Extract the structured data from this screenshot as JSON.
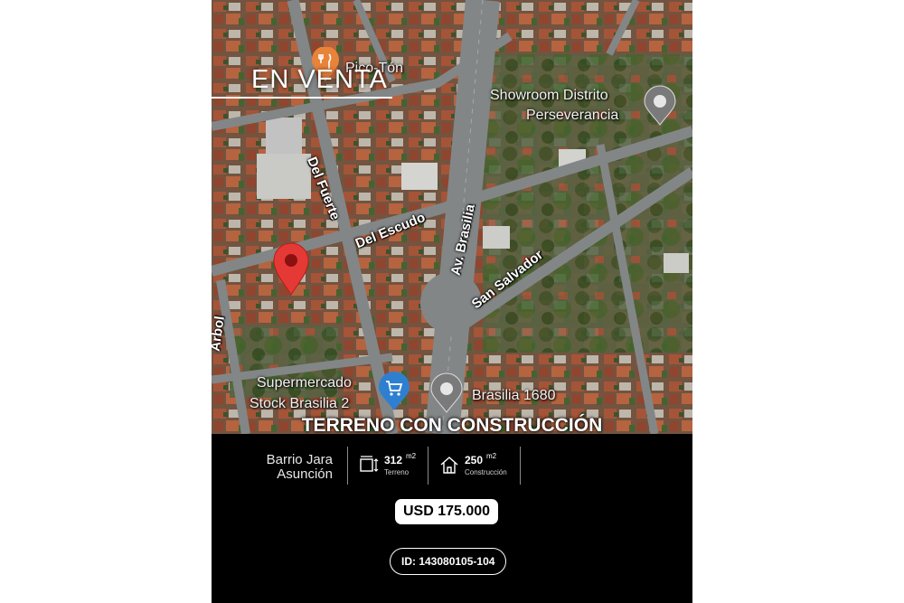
{
  "header": {
    "tag": "EN VENTA"
  },
  "map": {
    "streets": [
      "Del Fuerte",
      "Del Escudo",
      "Av. Brasilia",
      "San Salvador",
      "Arbol"
    ],
    "pois": [
      {
        "name": "Pico-Tón",
        "icon": "restaurant-icon"
      },
      {
        "name": "Showroom Distrito Perseverancia",
        "line1": "Showroom Distrito",
        "line2": "Perseverancia",
        "icon": "place-pin-icon"
      },
      {
        "name": "Supermercado Stock Brasilia 2",
        "line1": "Supermercado",
        "line2": "Stock Brasilia 2",
        "icon": "shopping-cart-icon"
      },
      {
        "name": "Brasilia 1680",
        "icon": "place-pin-icon"
      }
    ],
    "property_marker": "location-pin-icon"
  },
  "listing": {
    "title": "TERRENO CON CONSTRUCCIÓN",
    "location_line1": "Barrio Jara",
    "location_line2": "Asunción",
    "land": {
      "value": "312",
      "unit": "m2",
      "label": "Terreno"
    },
    "building": {
      "value": "250",
      "unit": "m2",
      "label": "Construcción"
    },
    "price": "USD 175.000",
    "id": "ID: 143080105-104"
  },
  "colors": {
    "background": "#000000",
    "marker_red": "#e53935",
    "cart_blue": "#2f7fd0",
    "pin_gray": "#7a7a7a"
  }
}
